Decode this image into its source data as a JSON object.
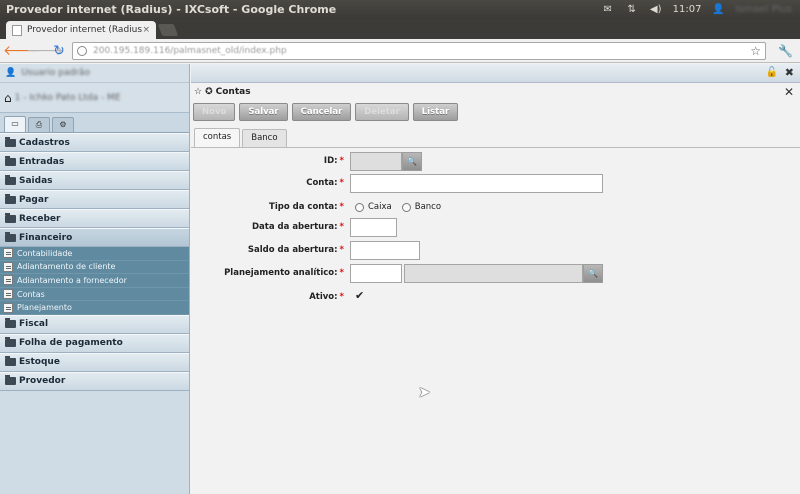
{
  "os": {
    "window_title": "Provedor internet (Radius) - IXCsoft - Google Chrome",
    "clock": "11:07",
    "user": "Ismael Plus"
  },
  "browser": {
    "tab_label": "Provedor internet (Radius",
    "tab_close": "×",
    "url": "200.195.189.116/palmasnet_old/index.php",
    "icons": [
      "back-arrow-icon",
      "forward-arrow-icon",
      "reload-icon",
      "star-icon",
      "wrench-icon"
    ]
  },
  "sidebar": {
    "user_name": "Usuario padrão",
    "company": "1 - Ichko Pato Ltda - ME",
    "menu_groups": [
      {
        "label": "Cadastros"
      },
      {
        "label": "Entradas"
      },
      {
        "label": "Saidas"
      },
      {
        "label": "Pagar"
      },
      {
        "label": "Receber"
      },
      {
        "label": "Financeiro",
        "open": true
      }
    ],
    "financeiro_items": [
      "Contabilidade",
      "Adiantamento de cliente",
      "Adiantamento a fornecedor",
      "Contas",
      "Planejamento"
    ],
    "menu_groups_after": [
      {
        "label": "Fiscal"
      },
      {
        "label": "Folha de pagamento"
      },
      {
        "label": "Estoque"
      },
      {
        "label": "Provedor"
      }
    ]
  },
  "main": {
    "window_title": "Contas",
    "buttons": {
      "novo": "Novo",
      "salvar": "Salvar",
      "cancelar": "Cancelar",
      "deletar": "Deletar",
      "listar": "Listar"
    },
    "tabs": [
      "contas",
      "Banco"
    ],
    "form": {
      "id_label": "ID:",
      "conta_label": "Conta:",
      "tipo_label": "Tipo da conta:",
      "tipo_options": [
        "Caixa",
        "Banco"
      ],
      "data_label": "Data da abertura:",
      "saldo_label": "Saldo da abertura:",
      "planejamento_label": "Planejamento analítico:",
      "ativo_label": "Ativo:",
      "required_mark": "*",
      "ativo_checked": true
    }
  }
}
